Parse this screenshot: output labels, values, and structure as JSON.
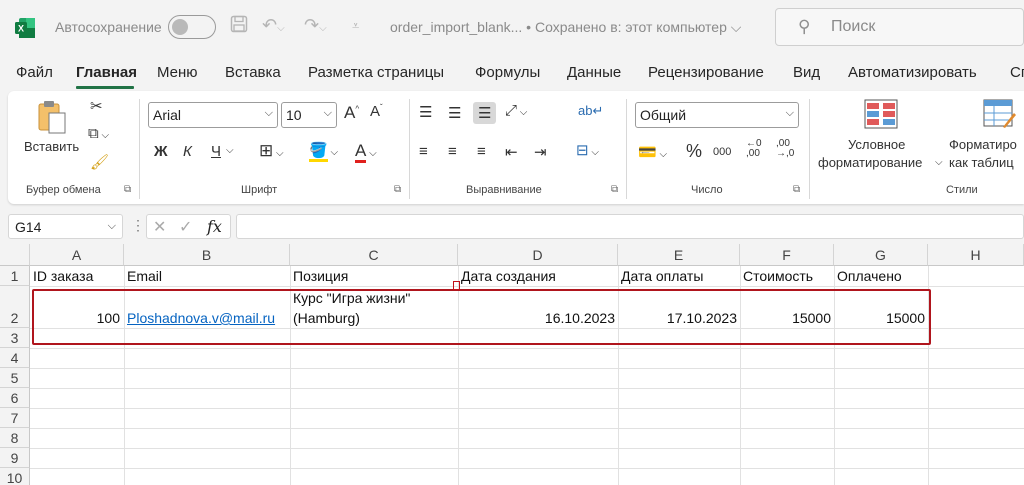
{
  "titlebar": {
    "autosave_label": "Автосохранение",
    "filename": "order_import_blank... • Сохранено в: этот компьютер ⌵",
    "search_placeholder": "Поиск"
  },
  "tabs": [
    "Файл",
    "Главная",
    "Меню",
    "Вставка",
    "Разметка страницы",
    "Формулы",
    "Данные",
    "Рецензирование",
    "Вид",
    "Автоматизировать",
    "Сп"
  ],
  "active_tab": "Главная",
  "ribbon": {
    "clipboard": {
      "paste_label": "Вставить",
      "group_label": "Буфер обмена"
    },
    "font": {
      "font_name": "Arial",
      "font_size": "10",
      "bold": "Ж",
      "italic": "К",
      "underline": "Ч",
      "group_label": "Шрифт"
    },
    "alignment": {
      "group_label": "Выравнивание"
    },
    "number": {
      "format": "Общий",
      "group_label": "Число"
    },
    "styles": {
      "conditional_line1": "Условное",
      "conditional_line2": "форматирование",
      "format_table_line1": "Форматиро",
      "format_table_line2": "как таблиц",
      "group_label": "Стили"
    }
  },
  "formula_bar": {
    "name_box": "G14",
    "fx_label": "fx",
    "formula": ""
  },
  "sheet": {
    "columns": [
      "A",
      "B",
      "C",
      "D",
      "E",
      "F",
      "G",
      "H"
    ],
    "rows": [
      "1",
      "2",
      "3",
      "4",
      "5",
      "6",
      "7",
      "8",
      "9",
      "10"
    ],
    "header_row": [
      "ID заказа",
      "Email",
      "Позиция",
      "Дата создания",
      "Дата оплаты",
      "Стоимость",
      "Оплачено"
    ],
    "data_row": {
      "id": "100",
      "email": "Ploshadnova.v@mail.ru",
      "position_line1": "Курс \"Игра жизни\"",
      "position_line2": "(Hamburg)",
      "created": "16.10.2023",
      "paid_date": "17.10.2023",
      "cost": "15000",
      "paid": "15000"
    }
  },
  "colors": {
    "excel_green": "#217346",
    "highlight_red": "#b0151d",
    "link_blue": "#0563c1"
  }
}
